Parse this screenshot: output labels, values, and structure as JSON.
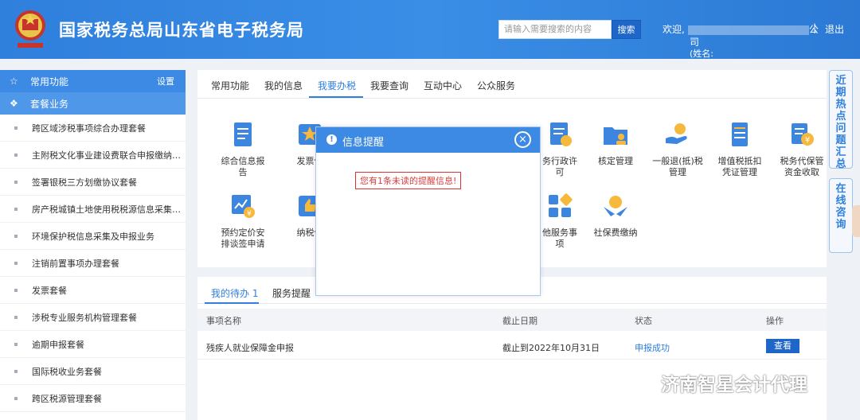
{
  "header": {
    "site_title": "国家税务总局山东省电子税务局",
    "search_placeholder": "请输入需要搜索的内容",
    "search_button": "搜索",
    "welcome_prefix": "欢迎,",
    "welcome_suffix": "公",
    "welcome_line2": "司",
    "welcome_line3": "(姓名:",
    "separator": "|",
    "logout": "退出"
  },
  "sidebar": {
    "header_label": "常用功能",
    "settings_label": "设置",
    "sub_label": "套餐业务",
    "items": [
      "跨区域涉税事项综合办理套餐",
      "主附税文化事业建设费联合申报缴纳套餐",
      "签署银税三方划缴协议套餐",
      "房产税城镇土地使用税税源信息采集及申报",
      "环境保护税信息采集及申报业务",
      "注销前置事项办理套餐",
      "发票套餐",
      "涉税专业服务机构管理套餐",
      "逾期申报套餐",
      "国际税收业务套餐",
      "跨区税源管理套餐"
    ]
  },
  "main": {
    "tabs": [
      "常用功能",
      "我的信息",
      "我要办税",
      "我要查询",
      "互动中心",
      "公众服务"
    ],
    "active_tab": "我要办税",
    "services_row1": [
      {
        "l1": "综合信息报",
        "l2": "告"
      },
      {
        "l1": "发票使",
        "l2": ""
      },
      {
        "l1": "务行政许",
        "l2": "可"
      },
      {
        "l1": "核定管理",
        "l2": ""
      },
      {
        "l1": "一般退(抵)税",
        "l2": "管理"
      },
      {
        "l1": "增值税抵扣",
        "l2": "凭证管理"
      },
      {
        "l1": "税务代保管",
        "l2": "资金收取"
      }
    ],
    "services_row2": [
      {
        "l1": "预约定价安",
        "l2": "排谈签申请"
      },
      {
        "l1": "纳税信",
        "l2": ""
      },
      {
        "l1": "他服务事",
        "l2": "项"
      },
      {
        "l1": "社保费缴纳",
        "l2": ""
      }
    ]
  },
  "todo": {
    "tab_active": "我的待办",
    "tab_active_count": "1",
    "tab_other": "服务提醒",
    "columns": [
      "事项名称",
      "截止日期",
      "状态",
      "操作"
    ],
    "rows": [
      {
        "name": "残疾人就业保障金申报",
        "deadline": "截止到2022年10月31日",
        "status": "申报成功",
        "action": "查看"
      }
    ]
  },
  "float_tabs": [
    "近期热点问题汇总",
    "在线咨询"
  ],
  "modal": {
    "title": "信息提醒",
    "message": "您有1条未读的提醒信息!",
    "close": "×"
  },
  "watermark": "济南智星会计代理",
  "colors": {
    "primary": "#2f7fdc",
    "header": "#3a8ee6",
    "button": "#1e66c8",
    "alert": "#e03030"
  }
}
